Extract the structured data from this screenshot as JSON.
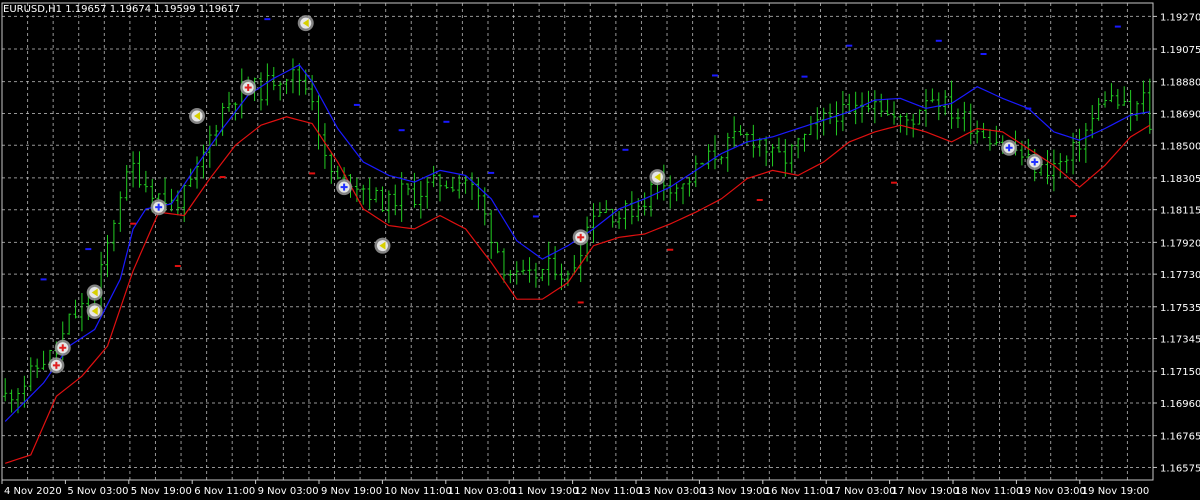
{
  "chart_data": {
    "type": "candlestick",
    "symbol_line": "EURUSD,H1  1.19657 1.19674 1.19599 1.19617",
    "ylim": [
      1.165,
      1.1935
    ],
    "grid": true,
    "colors": {
      "background": "#000000",
      "price_bars": "#22cc22",
      "upper_line": "#1a1aff",
      "lower_line": "#e01010",
      "grid": "#c8c8c8",
      "axis_text": "#ffffff",
      "signal_ring": "#9a9a9a"
    },
    "y_ticks": [
      "1.19270",
      "1.19075",
      "1.18880",
      "1.18690",
      "1.18500",
      "1.18305",
      "1.18115",
      "1.17920",
      "1.17730",
      "1.17535",
      "1.17345",
      "1.17150",
      "1.16960",
      "1.16765",
      "1.16575"
    ],
    "x_ticks": [
      "4 Nov 2020",
      "5 Nov 03:00",
      "5 Nov 19:00",
      "6 Nov 11:00",
      "9 Nov 03:00",
      "9 Nov 19:00",
      "10 Nov 11:00",
      "11 Nov 03:00",
      "11 Nov 19:00",
      "12 Nov 11:00",
      "13 Nov 03:00",
      "13 Nov 19:00",
      "16 Nov 11:00",
      "17 Nov 03:00",
      "17 Nov 19:00",
      "18 Nov 11:00",
      "19 Nov 03:00",
      "19 Nov 19:00"
    ],
    "price_path": [
      [
        0,
        1.17
      ],
      [
        3,
        1.1708
      ],
      [
        6,
        1.1722
      ],
      [
        8,
        1.1726
      ],
      [
        10,
        1.1745
      ],
      [
        12,
        1.1752
      ],
      [
        14,
        1.1758
      ],
      [
        16,
        1.179
      ],
      [
        18,
        1.1822
      ],
      [
        20,
        1.1837
      ],
      [
        22,
        1.1827
      ],
      [
        24,
        1.182
      ],
      [
        26,
        1.1815
      ],
      [
        28,
        1.182
      ],
      [
        30,
        1.1833
      ],
      [
        32,
        1.1855
      ],
      [
        34,
        1.1872
      ],
      [
        36,
        1.188
      ],
      [
        38,
        1.1885
      ],
      [
        40,
        1.1883
      ],
      [
        42,
        1.189
      ],
      [
        44,
        1.1893
      ],
      [
        46,
        1.189
      ],
      [
        48,
        1.188
      ],
      [
        50,
        1.184
      ],
      [
        52,
        1.1828
      ],
      [
        54,
        1.183
      ],
      [
        56,
        1.1825
      ],
      [
        58,
        1.1818
      ],
      [
        60,
        1.1815
      ],
      [
        62,
        1.1822
      ],
      [
        64,
        1.182
      ],
      [
        66,
        1.1825
      ],
      [
        68,
        1.1828
      ],
      [
        70,
        1.1828
      ],
      [
        72,
        1.183
      ],
      [
        74,
        1.1818
      ],
      [
        76,
        1.1797
      ],
      [
        78,
        1.1778
      ],
      [
        80,
        1.177
      ],
      [
        82,
        1.177
      ],
      [
        84,
        1.1775
      ],
      [
        86,
        1.1778
      ],
      [
        88,
        1.177
      ],
      [
        90,
        1.179
      ],
      [
        92,
        1.1812
      ],
      [
        94,
        1.1812
      ],
      [
        96,
        1.1808
      ],
      [
        98,
        1.1812
      ],
      [
        100,
        1.1818
      ],
      [
        102,
        1.183
      ],
      [
        104,
        1.1827
      ],
      [
        106,
        1.1825
      ],
      [
        108,
        1.1835
      ],
      [
        110,
        1.1842
      ],
      [
        112,
        1.1847
      ],
      [
        114,
        1.1853
      ],
      [
        116,
        1.1855
      ],
      [
        118,
        1.1853
      ],
      [
        120,
        1.1843
      ],
      [
        122,
        1.1842
      ],
      [
        124,
        1.185
      ],
      [
        126,
        1.1858
      ],
      [
        128,
        1.1865
      ],
      [
        130,
        1.187
      ],
      [
        132,
        1.1867
      ],
      [
        134,
        1.1875
      ],
      [
        136,
        1.188
      ],
      [
        138,
        1.1868
      ],
      [
        140,
        1.1864
      ],
      [
        142,
        1.1866
      ],
      [
        144,
        1.188
      ],
      [
        146,
        1.1878
      ],
      [
        148,
        1.187
      ],
      [
        150,
        1.1866
      ],
      [
        152,
        1.186
      ],
      [
        154,
        1.1856
      ],
      [
        156,
        1.1852
      ],
      [
        158,
        1.1847
      ],
      [
        160,
        1.184
      ],
      [
        162,
        1.1835
      ],
      [
        164,
        1.1838
      ],
      [
        166,
        1.184
      ],
      [
        168,
        1.1852
      ],
      [
        170,
        1.1865
      ],
      [
        172,
        1.188
      ],
      [
        174,
        1.1875
      ],
      [
        176,
        1.1868
      ],
      [
        178,
        1.1878
      ],
      [
        179,
        1.1862
      ]
    ],
    "upper_path": [
      [
        0,
        1.1685
      ],
      [
        6,
        1.1708
      ],
      [
        10,
        1.173
      ],
      [
        14,
        1.174
      ],
      [
        18,
        1.177
      ],
      [
        20,
        1.18
      ],
      [
        22,
        1.1812
      ],
      [
        26,
        1.1815
      ],
      [
        30,
        1.1838
      ],
      [
        34,
        1.186
      ],
      [
        38,
        1.188
      ],
      [
        42,
        1.189
      ],
      [
        46,
        1.1898
      ],
      [
        48,
        1.1888
      ],
      [
        52,
        1.186
      ],
      [
        56,
        1.184
      ],
      [
        60,
        1.1832
      ],
      [
        64,
        1.1828
      ],
      [
        68,
        1.1835
      ],
      [
        72,
        1.1832
      ],
      [
        76,
        1.1818
      ],
      [
        80,
        1.1793
      ],
      [
        84,
        1.1782
      ],
      [
        88,
        1.179
      ],
      [
        92,
        1.18
      ],
      [
        96,
        1.1812
      ],
      [
        100,
        1.1818
      ],
      [
        104,
        1.1825
      ],
      [
        108,
        1.1835
      ],
      [
        112,
        1.1845
      ],
      [
        116,
        1.1852
      ],
      [
        120,
        1.1855
      ],
      [
        124,
        1.186
      ],
      [
        128,
        1.1865
      ],
      [
        132,
        1.187
      ],
      [
        136,
        1.1877
      ],
      [
        140,
        1.1878
      ],
      [
        144,
        1.1872
      ],
      [
        148,
        1.1875
      ],
      [
        152,
        1.1885
      ],
      [
        156,
        1.1878
      ],
      [
        160,
        1.1872
      ],
      [
        164,
        1.1858
      ],
      [
        168,
        1.1853
      ],
      [
        172,
        1.186
      ],
      [
        176,
        1.1868
      ],
      [
        179,
        1.187
      ]
    ],
    "lower_path": [
      [
        0,
        1.166
      ],
      [
        4,
        1.1665
      ],
      [
        8,
        1.17
      ],
      [
        12,
        1.1712
      ],
      [
        16,
        1.173
      ],
      [
        20,
        1.1775
      ],
      [
        24,
        1.181
      ],
      [
        28,
        1.1808
      ],
      [
        32,
        1.183
      ],
      [
        36,
        1.185
      ],
      [
        40,
        1.1862
      ],
      [
        44,
        1.1867
      ],
      [
        48,
        1.1863
      ],
      [
        52,
        1.184
      ],
      [
        56,
        1.1812
      ],
      [
        60,
        1.1802
      ],
      [
        64,
        1.18
      ],
      [
        68,
        1.1808
      ],
      [
        72,
        1.18
      ],
      [
        76,
        1.178
      ],
      [
        80,
        1.1758
      ],
      [
        84,
        1.1758
      ],
      [
        88,
        1.1768
      ],
      [
        92,
        1.179
      ],
      [
        96,
        1.1795
      ],
      [
        100,
        1.1797
      ],
      [
        104,
        1.1803
      ],
      [
        108,
        1.181
      ],
      [
        112,
        1.1818
      ],
      [
        116,
        1.183
      ],
      [
        120,
        1.1835
      ],
      [
        124,
        1.1832
      ],
      [
        128,
        1.184
      ],
      [
        132,
        1.1852
      ],
      [
        136,
        1.1858
      ],
      [
        140,
        1.1862
      ],
      [
        144,
        1.1858
      ],
      [
        148,
        1.1852
      ],
      [
        152,
        1.186
      ],
      [
        156,
        1.1858
      ],
      [
        160,
        1.1848
      ],
      [
        164,
        1.1838
      ],
      [
        168,
        1.1825
      ],
      [
        172,
        1.1838
      ],
      [
        176,
        1.1855
      ],
      [
        179,
        1.1862
      ]
    ],
    "signals": [
      {
        "i": 8,
        "price": 1.17185,
        "dir": "up",
        "mark": "red"
      },
      {
        "i": 9,
        "price": 1.1729,
        "dir": "up",
        "mark": "red"
      },
      {
        "i": 14,
        "price": 1.1751,
        "dir": "left",
        "mark": "yellow"
      },
      {
        "i": 14,
        "price": 1.1762,
        "dir": "left",
        "mark": "yellow"
      },
      {
        "i": 24,
        "price": 1.1813,
        "dir": "down",
        "mark": "blue"
      },
      {
        "i": 30,
        "price": 1.18675,
        "dir": "left",
        "mark": "yellow"
      },
      {
        "i": 38,
        "price": 1.18845,
        "dir": "up",
        "mark": "red"
      },
      {
        "i": 47,
        "price": 1.1923,
        "dir": "left",
        "mark": "yellow"
      },
      {
        "i": 53,
        "price": 1.1825,
        "dir": "down",
        "mark": "blue"
      },
      {
        "i": 59,
        "price": 1.179,
        "dir": "left",
        "mark": "yellow"
      },
      {
        "i": 90,
        "price": 1.1795,
        "dir": "up",
        "mark": "red"
      },
      {
        "i": 102,
        "price": 1.1831,
        "dir": "left",
        "mark": "yellow"
      },
      {
        "i": 157,
        "price": 1.18485,
        "dir": "down",
        "mark": "blue"
      },
      {
        "i": 161,
        "price": 1.184,
        "dir": "down",
        "mark": "blue"
      }
    ]
  }
}
